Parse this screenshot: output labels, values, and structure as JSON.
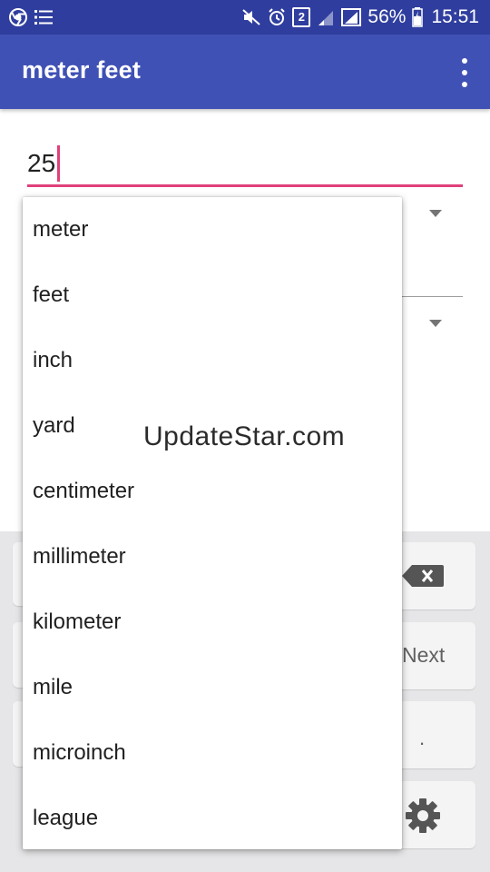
{
  "status_bar": {
    "battery": "56%",
    "time": "15:51",
    "sim_slot": "2",
    "icons": [
      "chrome-icon",
      "list-icon",
      "mute-icon",
      "alarm-icon",
      "sim-2-icon",
      "signal-icon",
      "signal-icon",
      "battery-icon"
    ]
  },
  "app_bar": {
    "title": "meter feet",
    "overflow_icon": "more-vert-icon"
  },
  "input": {
    "value": "25"
  },
  "dropdown": {
    "options": [
      "meter",
      "feet",
      "inch",
      "yard",
      "centimeter",
      "millimeter",
      "kilometer",
      "mile",
      "microinch",
      "league"
    ]
  },
  "keyboard": {
    "next_label": "Next",
    "dot_label": ".",
    "icons": [
      "backspace-icon",
      "settings-icon"
    ]
  },
  "watermark": "UpdateStar.com",
  "colors": {
    "status_bar": "#2f3e9e",
    "app_bar": "#3f51b5",
    "accent": "#e0407a"
  }
}
